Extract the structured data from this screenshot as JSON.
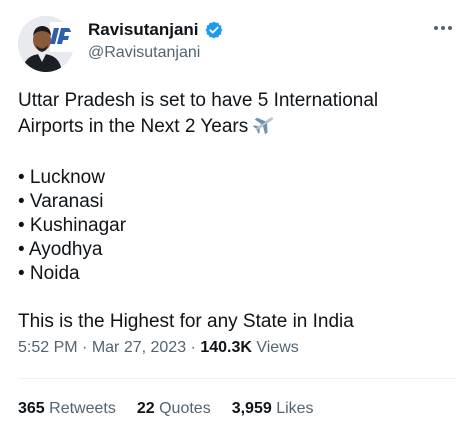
{
  "author": {
    "display_name": "Ravisutanjani",
    "handle": "@Ravisutanjani",
    "verified_icon": "verified-badge-icon",
    "verified_color": "#1d9bf0"
  },
  "tweet": {
    "line1": "Uttar Pradesh is set to have 5 International",
    "line2": "Airports in the Next 2 Years",
    "emoji_icon": "airplane-icon",
    "bullets": [
      "• Lucknow",
      "• Varanasi",
      "• Kushinagar",
      "• Ayodhya",
      "• Noida"
    ],
    "closing": "This is the Highest for any State in India"
  },
  "meta": {
    "time": "5:52 PM",
    "separator": " · ",
    "date": "Mar 27, 2023",
    "separator2": " · ",
    "views_count": "140.3K",
    "views_label": " Views"
  },
  "stats": {
    "retweets_count": "365",
    "retweets_label": "Retweets",
    "quotes_count": "22",
    "quotes_label": "Quotes",
    "likes_count": "3,959",
    "likes_label": "Likes"
  },
  "colors": {
    "text_primary": "#0f1419",
    "text_secondary": "#536471",
    "divider": "#eff3f4"
  }
}
